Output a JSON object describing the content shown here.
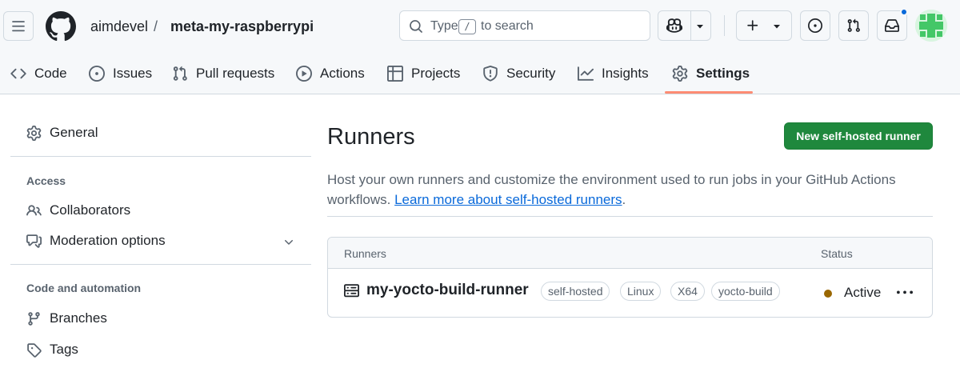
{
  "header": {
    "owner": "aimdevel",
    "separator": "/",
    "repo": "meta-my-raspberrypi",
    "search": {
      "prefix": "Type",
      "key": "/",
      "suffix": "to search"
    },
    "notification_color": "#0969da"
  },
  "tabs": [
    {
      "label": "Code",
      "icon": "code-icon"
    },
    {
      "label": "Issues",
      "icon": "issue-opened-icon"
    },
    {
      "label": "Pull requests",
      "icon": "git-pull-request-icon"
    },
    {
      "label": "Actions",
      "icon": "play-icon"
    },
    {
      "label": "Projects",
      "icon": "table-icon"
    },
    {
      "label": "Security",
      "icon": "shield-icon"
    },
    {
      "label": "Insights",
      "icon": "graph-icon"
    },
    {
      "label": "Settings",
      "icon": "gear-icon",
      "selected": true
    }
  ],
  "sidebar": {
    "general": "General",
    "access_heading": "Access",
    "collaborators": "Collaborators",
    "moderation": "Moderation options",
    "code_heading": "Code and automation",
    "branches": "Branches",
    "tags": "Tags"
  },
  "main": {
    "title": "Runners",
    "new_button": "New self-hosted runner",
    "description": "Host your own runners and customize the environment used to run jobs in your GitHub Actions workflows.",
    "learn_more": "Learn more about self-hosted runners",
    "learn_more_suffix": ".",
    "table": {
      "col_runners": "Runners",
      "col_status": "Status",
      "runner": {
        "name": "my-yocto-build-runner",
        "labels": [
          "self-hosted",
          "Linux",
          "X64",
          "yocto-build"
        ],
        "status": "Active",
        "status_color": "#9a6700"
      }
    }
  },
  "colors": {
    "accent_button": "#1f883d",
    "link": "#0969da",
    "tab_underline": "#fd8c73"
  }
}
